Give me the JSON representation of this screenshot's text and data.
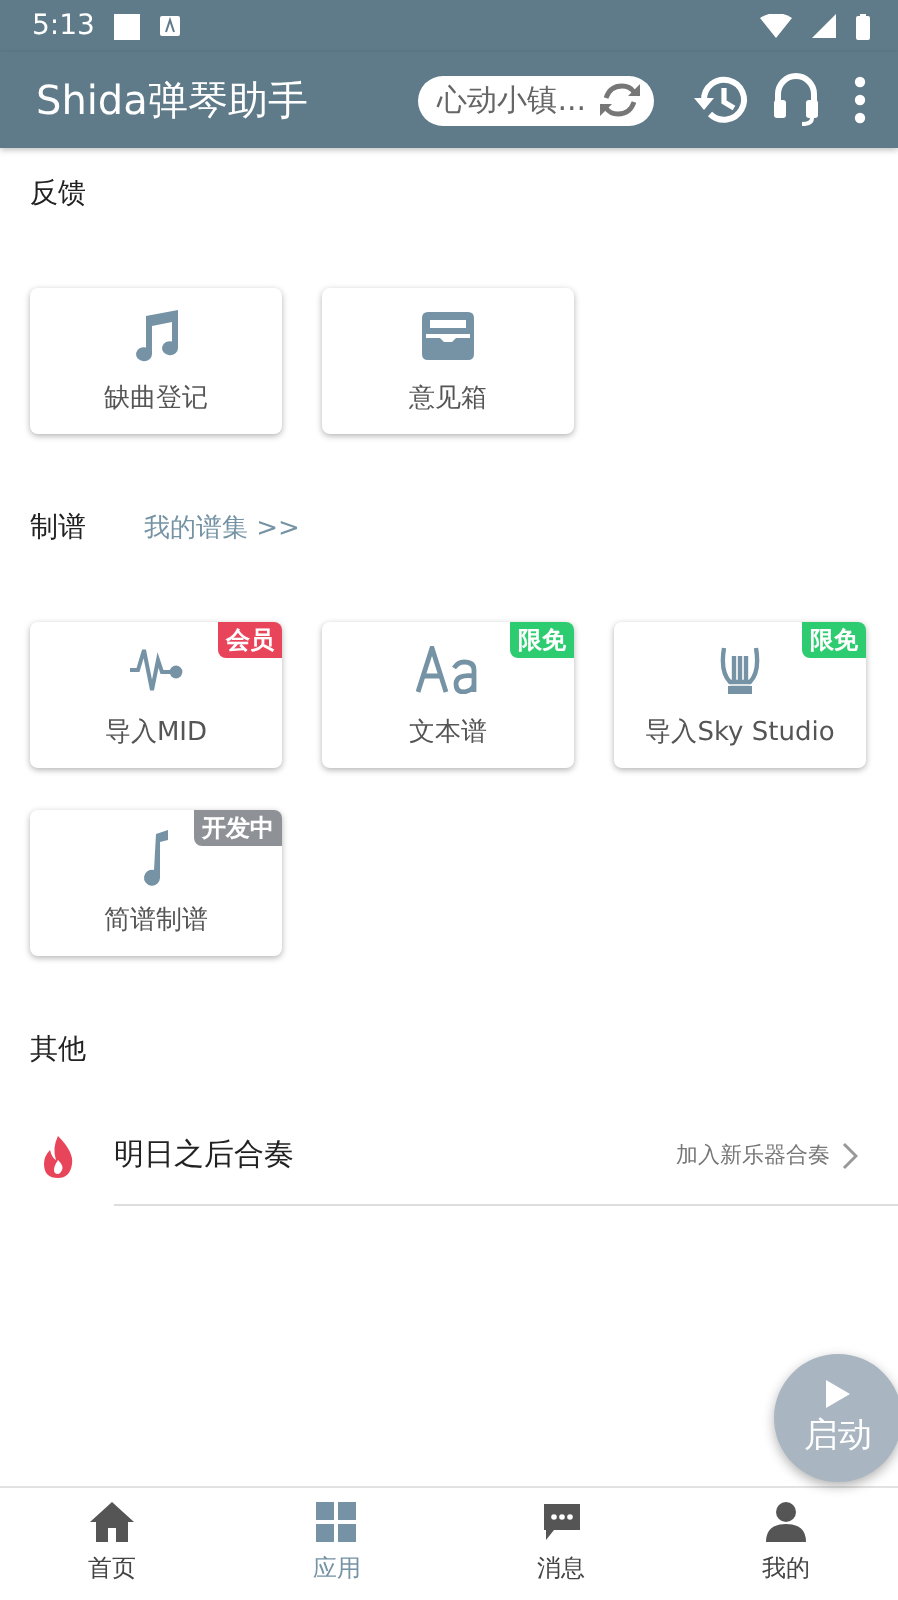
{
  "status_bar": {
    "time": "5:13"
  },
  "app_bar": {
    "title": "Shida弹琴助手",
    "server": "心动小镇..."
  },
  "sections": [
    {
      "title": "反馈",
      "cards": [
        {
          "label": "缺曲登记"
        },
        {
          "label": "意见箱"
        }
      ]
    },
    {
      "title": "制谱",
      "link": "我的谱集 >>",
      "cards": [
        {
          "label": "导入MID",
          "badge": {
            "text": "会员",
            "color": "#e8455a"
          }
        },
        {
          "label": "文本谱",
          "badge": {
            "text": "限免",
            "color": "#2ecc71"
          }
        },
        {
          "label": "导入Sky Studio",
          "badge": {
            "text": "限免",
            "color": "#2ecc71"
          }
        },
        {
          "label": "简谱制谱",
          "badge": {
            "text": "开发中",
            "color": "#8e9297"
          }
        }
      ]
    },
    {
      "title": "其他",
      "rows": [
        {
          "title": "明日之后合奏",
          "action": "加入新乐器合奏"
        }
      ]
    }
  ],
  "fab": {
    "label": "启动"
  },
  "bottom_nav": [
    {
      "label": "首页",
      "selected": false
    },
    {
      "label": "应用",
      "selected": true
    },
    {
      "label": "消息",
      "selected": false
    },
    {
      "label": "我的",
      "selected": false
    }
  ]
}
